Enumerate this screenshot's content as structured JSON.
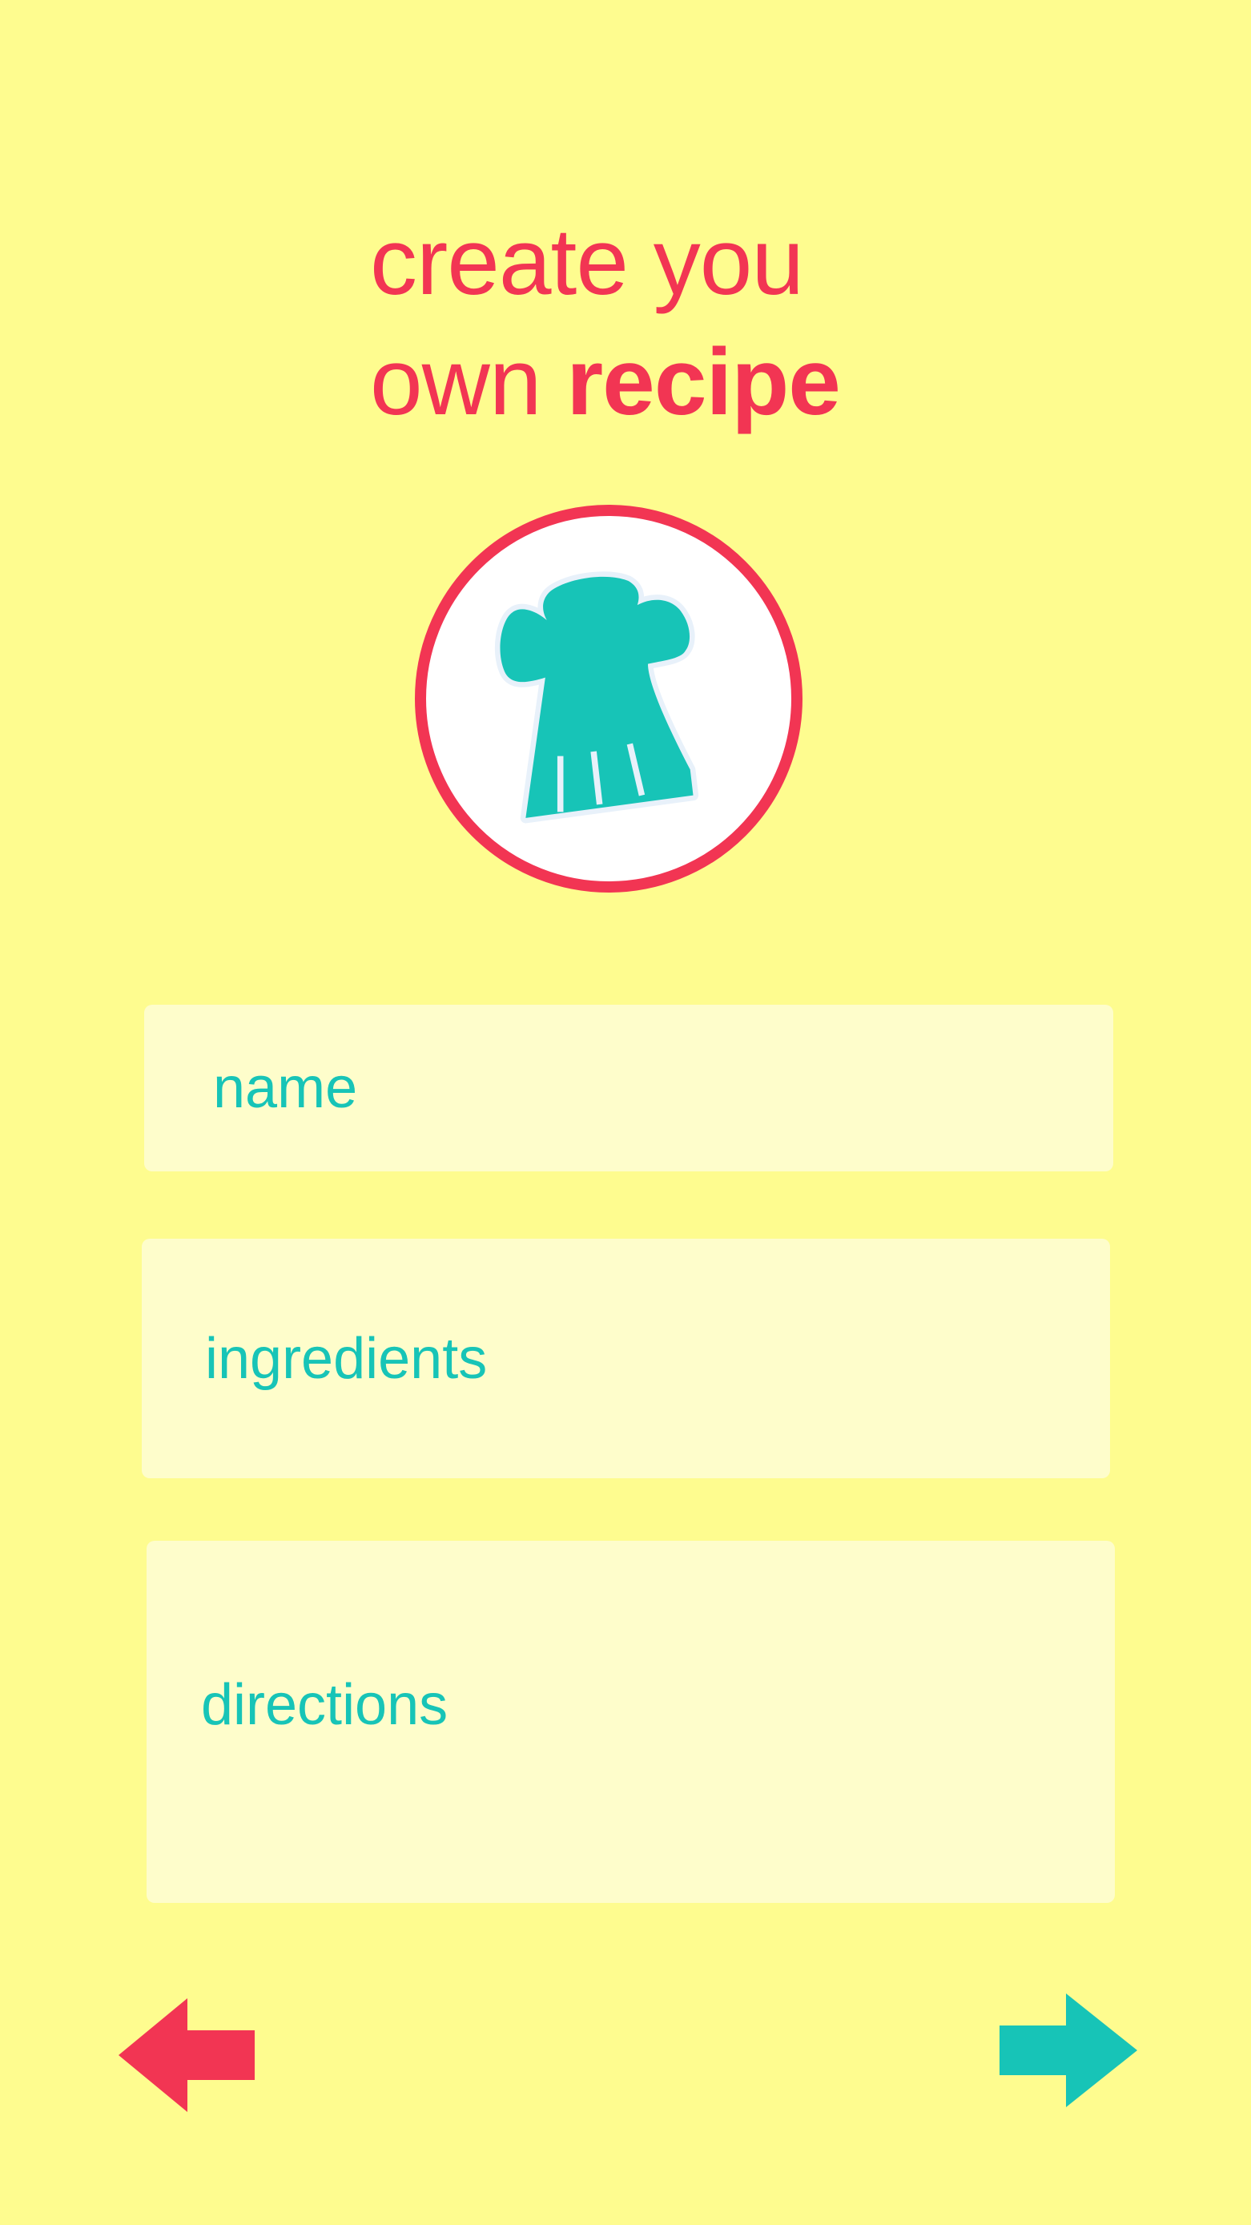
{
  "header": {
    "title_line1": "create you",
    "title_line2_prefix": "own ",
    "title_line2_bold": "recipe"
  },
  "avatar": {
    "icon": "chef-hat-icon"
  },
  "form": {
    "name_placeholder": "name",
    "ingredients_placeholder": "ingredients",
    "directions_placeholder": "directions"
  },
  "navigation": {
    "back_icon": "arrow-left-icon",
    "next_icon": "arrow-right-icon"
  },
  "colors": {
    "background": "#FEFC8F",
    "field_background": "#FEFDCB",
    "accent_red": "#F23553",
    "accent_teal": "#17C4B7"
  }
}
